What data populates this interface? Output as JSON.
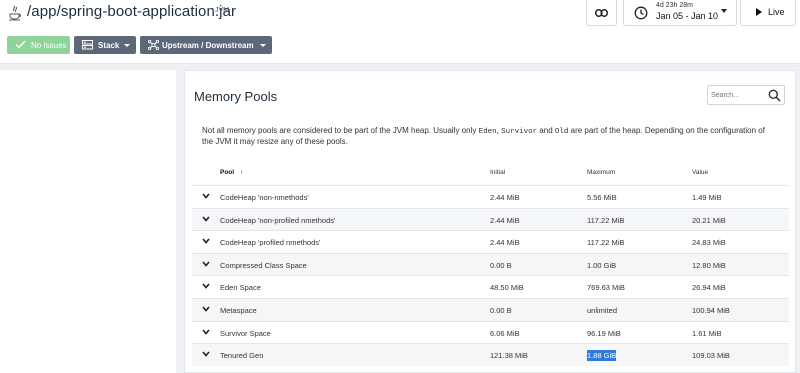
{
  "header": {
    "app_title": "/app/spring-boot-application.jar",
    "app_tag": "JVM",
    "time": {
      "duration": "4d 23h 28m",
      "range": "Jan 05 - Jan 10"
    },
    "live_label": "Live",
    "no_issues_label": "No Issues",
    "stack_label": "Stack",
    "updown_label": "Upstream / Downstream"
  },
  "panel": {
    "title": "Memory Pools",
    "search_placeholder": "Search...",
    "description": {
      "part1": "Not all memory pools are considered to be part of the JVM heap. Usually only ",
      "eden": "Eden",
      "sep1": ", ",
      "survivor": "Survivor",
      "sep2": " and ",
      "old": "Old",
      "part2": " are part of the heap. Depending on the configuration of the JVM it may resize any of these pools."
    },
    "columns": {
      "pool": "Pool",
      "sort_arrow": "↑",
      "initial": "Initial",
      "maximum": "Maximum",
      "value": "Value"
    },
    "rows": [
      {
        "pool": "CodeHeap 'non-nmethods'",
        "initial": "2.44 MiB",
        "maximum": "5.56 MiB",
        "value": "1.49 MiB"
      },
      {
        "pool": "CodeHeap 'non-profiled nmethods'",
        "initial": "2.44 MiB",
        "maximum": "117.22 MiB",
        "value": "20.21 MiB"
      },
      {
        "pool": "CodeHeap 'profiled nmethods'",
        "initial": "2.44 MiB",
        "maximum": "117.22 MiB",
        "value": "24.83 MiB"
      },
      {
        "pool": "Compressed Class Space",
        "initial": "0.00 B",
        "maximum": "1.00 GiB",
        "value": "12.80 MiB"
      },
      {
        "pool": "Eden Space",
        "initial": "48.50 MiB",
        "maximum": "769.63 MiB",
        "value": "26.94 MiB"
      },
      {
        "pool": "Metaspace",
        "initial": "0.00 B",
        "maximum": "unlimited",
        "value": "100.94 MiB"
      },
      {
        "pool": "Survivor Space",
        "initial": "6.06 MiB",
        "maximum": "96.19 MiB",
        "value": "1.61 MiB"
      },
      {
        "pool": "Tenured Gen",
        "initial": "121.38 MiB",
        "maximum": "1.88 GiB",
        "value": "109.03 MiB"
      }
    ]
  },
  "colors": {
    "success": "#8fd39b",
    "toolbar_button": "#5c6878",
    "selection": "#2f7bdc"
  },
  "icons": [
    "java-icon",
    "link-icon",
    "clock-icon",
    "play-icon",
    "check-icon",
    "stack-icon",
    "topology-icon",
    "search-icon",
    "chevron-down-icon"
  ]
}
